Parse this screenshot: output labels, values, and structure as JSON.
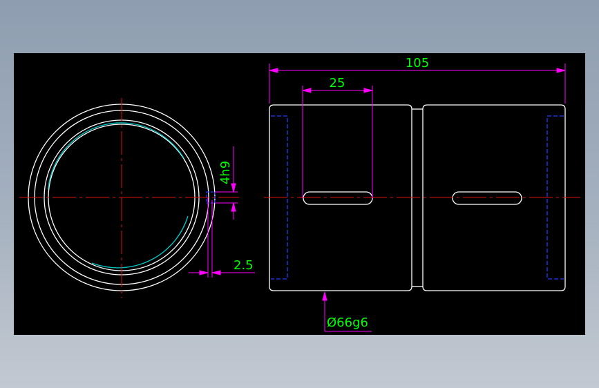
{
  "drawing": {
    "dimensions": {
      "overall_length": "105",
      "slot_length": "25",
      "slot_width": "4h9",
      "wall_offset": "2.5",
      "outer_diameter": "Ø66g6"
    },
    "colors": {
      "background": "#000000",
      "outline": "#ffffff",
      "centerline": "#e01010",
      "dimension_line": "#ff00ff",
      "dimension_text": "#00ff00",
      "hidden_line": "#1f3cff",
      "thread": "#00c8c8",
      "frame": "#9aa6b5"
    }
  }
}
